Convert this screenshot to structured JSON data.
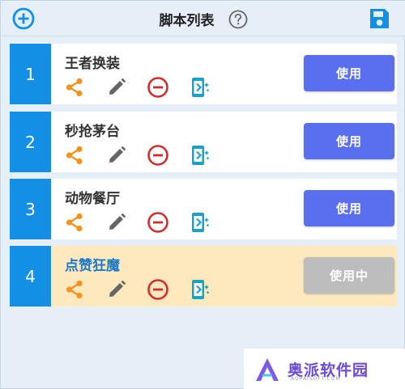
{
  "header": {
    "title": "脚本列表",
    "add_icon": "plus-circle-icon",
    "help_icon": "help-circle-icon",
    "save_icon": "save-icon"
  },
  "scripts": [
    {
      "index": "1",
      "name": "王者换装",
      "button": "使用",
      "active": false
    },
    {
      "index": "2",
      "name": "秒抢茅台",
      "button": "使用",
      "active": false
    },
    {
      "index": "3",
      "name": "动物餐厅",
      "button": "使用",
      "active": false
    },
    {
      "index": "4",
      "name": "点赞狂魔",
      "button": "使用中",
      "active": true
    }
  ],
  "row_icons": [
    "share-icon",
    "pencil-icon",
    "minus-circle-icon",
    "run-script-icon"
  ],
  "watermark": {
    "text": "奥派软件园",
    "sub": "AOPAISOFT.COM"
  },
  "colors": {
    "primary": "#148fe6",
    "button": "#5a6ef0",
    "button_inuse": "#bdbdbd",
    "share": "#f5921e",
    "edit": "#666666",
    "delete": "#d22d2d",
    "run": "#16a3c4",
    "active_row": "#fde9bd",
    "active_name": "#1e78c8"
  }
}
